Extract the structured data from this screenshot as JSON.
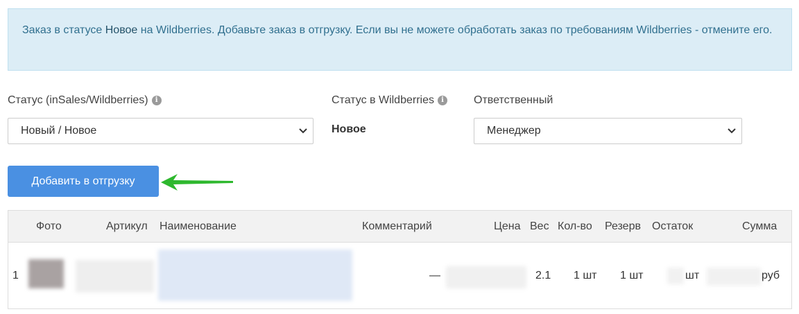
{
  "alert": {
    "text_before": "Заказ в статусе ",
    "status_word": "Новое",
    "text_after": " на Wildberries. Добавьте заказ в отгрузку. Если вы не можете обработать заказ по требованиям Wildberries - отмените его."
  },
  "form": {
    "status_label": "Статус (inSales/Wildberries)",
    "status_value": "Новый / Новое",
    "wb_status_label": "Статус в Wildberries",
    "wb_status_value": "Новое",
    "responsible_label": "Ответственный",
    "responsible_value": "Менеджер"
  },
  "actions": {
    "add_to_shipment": "Добавить в отгрузку"
  },
  "table": {
    "headers": {
      "photo": "Фото",
      "article": "Артикул",
      "name": "Наименование",
      "comment": "Комментарий",
      "price": "Цена",
      "weight": "Вес",
      "qty": "Кол-во",
      "reserve": "Резерв",
      "stock": "Остаток",
      "sum": "Сумма"
    },
    "rows": [
      {
        "index": "1",
        "comment": "—",
        "weight": "2.1",
        "qty": "1 шт",
        "reserve": "1 шт",
        "stock_unit": "шт",
        "sum_unit": "руб"
      }
    ]
  },
  "colors": {
    "alert_bg": "#dcedf6",
    "alert_text": "#31708f",
    "primary": "#4a90e2",
    "arrow": "#2eb82e"
  },
  "icons": [
    "info-icon",
    "chevron-down-icon",
    "arrow-left-icon"
  ]
}
